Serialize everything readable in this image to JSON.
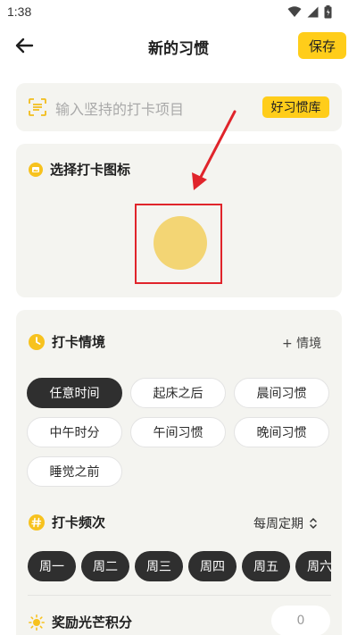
{
  "status_bar": {
    "time": "1:38"
  },
  "header": {
    "title": "新的习惯",
    "save_label": "保存"
  },
  "habit_input": {
    "placeholder": "输入坚持的打卡项目",
    "library_label": "好习惯库"
  },
  "icon_section": {
    "title": "选择打卡图标",
    "selected_icon_color": "#f3d574"
  },
  "scene_section": {
    "title": "打卡情境",
    "add_label": "+ 情境",
    "chips": [
      {
        "label": "任意时间",
        "selected": true
      },
      {
        "label": "起床之后",
        "selected": false
      },
      {
        "label": "晨间习惯",
        "selected": false
      },
      {
        "label": "中午时分",
        "selected": false
      },
      {
        "label": "午间习惯",
        "selected": false
      },
      {
        "label": "晚间习惯",
        "selected": false
      },
      {
        "label": "睡觉之前",
        "selected": false
      }
    ]
  },
  "frequency_section": {
    "title": "打卡频次",
    "mode": "每周定期",
    "days": [
      "周一",
      "周二",
      "周三",
      "周四",
      "周五",
      "周六"
    ]
  },
  "reward_section": {
    "title": "奖励光芒积分",
    "value": "0"
  },
  "colors": {
    "accent": "#ffcd1a",
    "card_bg": "#f4f4f0",
    "chip_active": "#2f2f2f",
    "annotation_red": "#e0242b"
  }
}
